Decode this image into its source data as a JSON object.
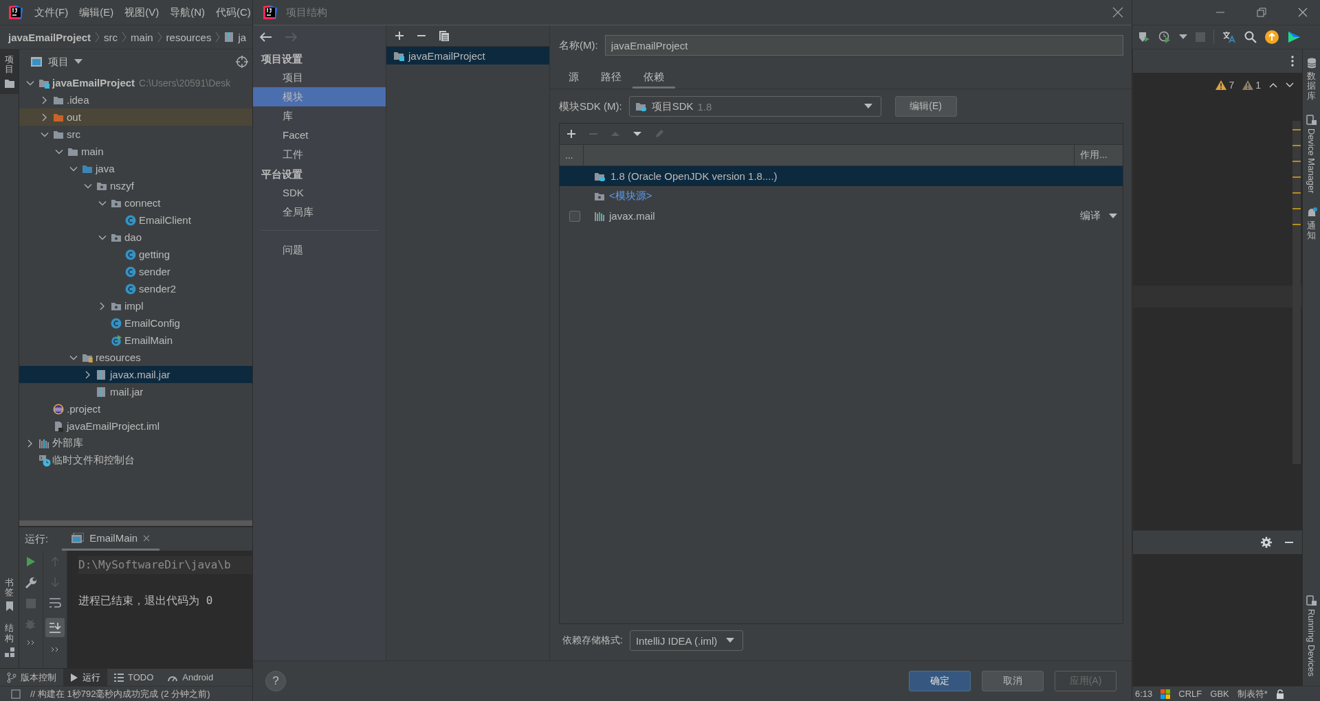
{
  "ide": {
    "menu": [
      "文件(F)",
      "编辑(E)",
      "视图(V)",
      "导航(N)",
      "代码(C)"
    ],
    "breadcrumbs": [
      {
        "label": "javaEmailProject",
        "kind": "dir"
      },
      {
        "label": "src",
        "kind": "dir"
      },
      {
        "label": "main",
        "kind": "dir"
      },
      {
        "label": "resources",
        "kind": "dir"
      },
      {
        "label": "ja",
        "kind": "jar"
      }
    ],
    "left_stripe_top": [
      {
        "label": "项目",
        "selected": true
      }
    ],
    "left_stripe_bottom": [
      "书签",
      "结构"
    ],
    "project_panel": {
      "title": "项目",
      "tree": [
        {
          "label": "javaEmailProject",
          "kind": "module",
          "hint": "C:\\Users\\20591\\Desk",
          "expanded": true,
          "selected": false,
          "children": [
            {
              "label": ".idea",
              "kind": "folder",
              "expanded": false,
              "selected": false
            },
            {
              "label": "out",
              "kind": "excluded",
              "expanded": false,
              "selected": false
            },
            {
              "label": "src",
              "kind": "folder",
              "expanded": true,
              "selected": false,
              "children": [
                {
                  "label": "main",
                  "kind": "folder",
                  "expanded": true,
                  "selected": false,
                  "children": [
                    {
                      "label": "java",
                      "kind": "source",
                      "expanded": true,
                      "selected": false,
                      "children": [
                        {
                          "label": "nszyf",
                          "kind": "package",
                          "expanded": true,
                          "selected": false,
                          "children": [
                            {
                              "label": "connect",
                              "kind": "package",
                              "expanded": true,
                              "selected": false,
                              "children": [
                                {
                                  "label": "EmailClient",
                                  "kind": "class",
                                  "selected": false
                                }
                              ]
                            },
                            {
                              "label": "dao",
                              "kind": "package",
                              "expanded": true,
                              "selected": false,
                              "children": [
                                {
                                  "label": "getting",
                                  "kind": "class",
                                  "selected": false
                                },
                                {
                                  "label": "sender",
                                  "kind": "class",
                                  "selected": false
                                },
                                {
                                  "label": "sender2",
                                  "kind": "class",
                                  "selected": false
                                }
                              ]
                            },
                            {
                              "label": "impl",
                              "kind": "package",
                              "expanded": false,
                              "selected": false
                            },
                            {
                              "label": "EmailConfig",
                              "kind": "class",
                              "selected": false
                            },
                            {
                              "label": "EmailMain",
                              "kind": "main-class",
                              "selected": false
                            }
                          ]
                        }
                      ]
                    },
                    {
                      "label": "resources",
                      "kind": "resources",
                      "expanded": true,
                      "selected": false,
                      "children": [
                        {
                          "label": "javax.mail.jar",
                          "kind": "jar",
                          "expanded": false,
                          "selected": true
                        },
                        {
                          "label": "mail.jar",
                          "kind": "jar",
                          "selected": false
                        }
                      ]
                    }
                  ]
                }
              ]
            },
            {
              "label": ".project",
              "kind": "eclipse",
              "selected": false
            },
            {
              "label": "javaEmailProject.iml",
              "kind": "iml",
              "selected": false
            }
          ]
        },
        {
          "label": "外部库",
          "kind": "libraries",
          "expanded": false,
          "selected": false
        },
        {
          "label": "临时文件和控制台",
          "kind": "scratch",
          "selected": false
        }
      ]
    },
    "run_panel": {
      "label": "运行:",
      "tab": "EmailMain",
      "console": [
        "D:\\MySoftwareDir\\java\\b",
        "进程已结束，退出代码为 0"
      ]
    },
    "bottom_tabs": [
      {
        "label": "版本控制",
        "selected": false
      },
      {
        "label": "运行",
        "selected": true
      },
      {
        "label": "TODO",
        "selected": false
      },
      {
        "label": "Android",
        "selected": false
      }
    ],
    "status": "// 构建在 1秒792毫秒内成功完成 (2 分钟之前)",
    "inspections": [
      "7",
      "1"
    ],
    "right_stripe": [
      {
        "label": "数据库",
        "kind": "cjk"
      },
      {
        "label": "Device Manager",
        "kind": "latin"
      },
      {
        "label": "通知",
        "kind": "cjk"
      },
      {
        "label": "Running Devices",
        "kind": "latin"
      }
    ],
    "status_right": [
      "6:13",
      "CRLF",
      "GBK",
      "制表符*"
    ]
  },
  "dialog": {
    "title": "项目结构",
    "nav_groups": [
      {
        "header": "项目设置",
        "items": [
          {
            "label": "项目",
            "selected": false
          },
          {
            "label": "模块",
            "selected": true
          },
          {
            "label": "库",
            "selected": false
          },
          {
            "label": "Facet",
            "selected": false
          },
          {
            "label": "工件",
            "selected": false
          }
        ]
      },
      {
        "header": "平台设置",
        "items": [
          {
            "label": "SDK",
            "selected": false
          },
          {
            "label": "全局库",
            "selected": false
          }
        ]
      },
      {
        "items": [
          {
            "label": "问题",
            "selected": false
          }
        ]
      }
    ],
    "modules": [
      {
        "label": "javaEmailProject",
        "selected": true
      }
    ],
    "name_label": "名称(M):",
    "name_value": "javaEmailProject",
    "tabs": [
      {
        "label": "源",
        "selected": false
      },
      {
        "label": "路径",
        "selected": false
      },
      {
        "label": "依赖",
        "selected": true
      }
    ],
    "sdk_label": "模块SDK (M):",
    "sdk_value": "项目SDK",
    "sdk_version": "1.8",
    "edit_button": "编辑(E)",
    "dep_toolbar": [
      {
        "kind": "add",
        "disabled": false
      },
      {
        "kind": "remove",
        "disabled": true
      },
      {
        "kind": "up",
        "disabled": true
      },
      {
        "kind": "down",
        "disabled": false
      },
      {
        "kind": "edit",
        "disabled": true
      }
    ],
    "dep_columns": [
      "...",
      "作用..."
    ],
    "dependencies": [
      {
        "kind": "sdk",
        "label": "1.8 (Oracle OpenJDK version 1.8....)",
        "selected": true
      },
      {
        "kind": "source",
        "label": "<模块源>",
        "selected": false
      },
      {
        "kind": "library",
        "label": "javax.mail",
        "checked": false,
        "scope": "编译",
        "selected": false
      }
    ],
    "storage_label": "依赖存储格式:",
    "storage_value": "IntelliJ IDEA (.iml)",
    "help": "?",
    "buttons": [
      {
        "label": "确定",
        "primary": true,
        "disabled": false
      },
      {
        "label": "取消",
        "primary": false,
        "disabled": false
      },
      {
        "label": "应用(A)",
        "primary": false,
        "disabled": true
      }
    ]
  }
}
